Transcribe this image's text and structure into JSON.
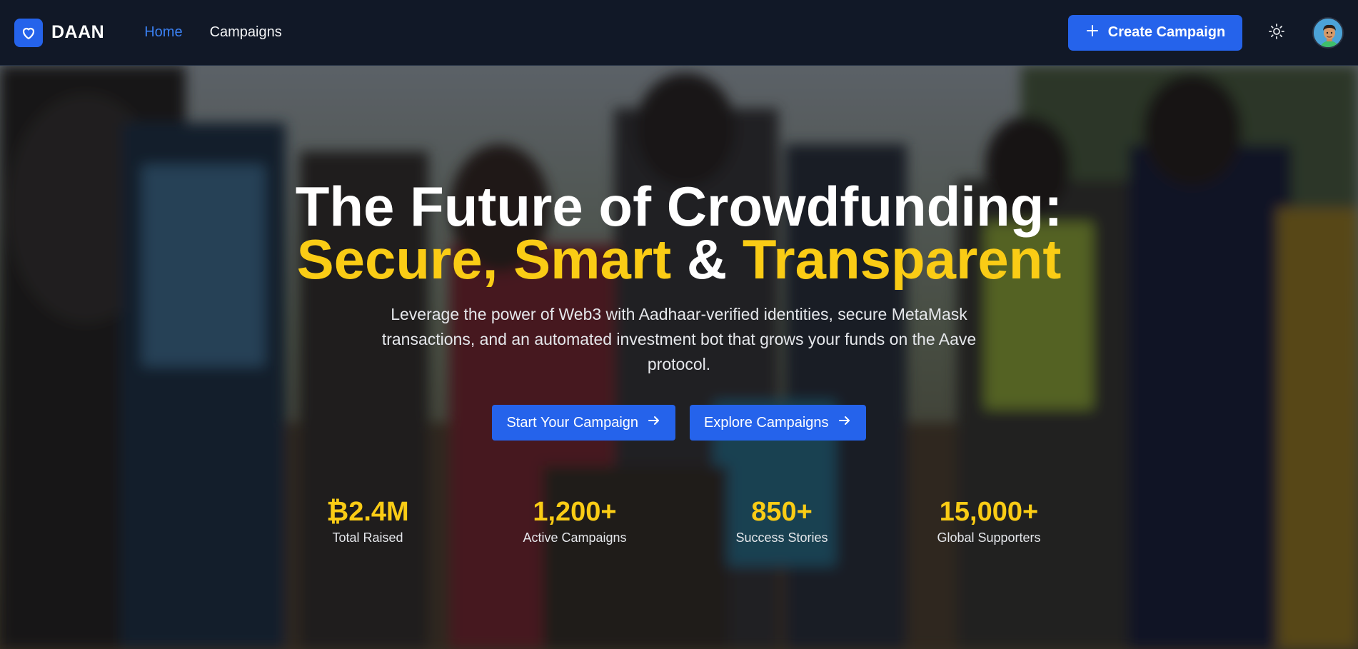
{
  "brand": {
    "name": "DAAN",
    "logo_icon": "heart-icon"
  },
  "nav": {
    "items": [
      {
        "label": "Home",
        "active": true
      },
      {
        "label": "Campaigns",
        "active": false
      }
    ]
  },
  "header_actions": {
    "create_label": "Create Campaign",
    "create_icon": "plus-icon",
    "theme_icon": "sun-icon",
    "avatar_icon": "user-avatar"
  },
  "hero": {
    "title_line1": "The Future of Crowdfunding:",
    "title_line2_part1": "Secure, Smart",
    "title_line2_amp": " & ",
    "title_line2_part2": "Transparent",
    "subtitle": "Leverage the power of Web3 with Aadhaar-verified identities, secure MetaMask transactions, and an automated investment bot that grows your funds on the Aave protocol.",
    "cta_primary": "Start Your Campaign",
    "cta_secondary": "Explore Campaigns",
    "cta_icon": "arrow-right-icon"
  },
  "stats": [
    {
      "value": "₿2.4M",
      "label": "Total Raised"
    },
    {
      "value": "1,200+",
      "label": "Active Campaigns"
    },
    {
      "value": "850+",
      "label": "Success Stories"
    },
    {
      "value": "15,000+",
      "label": "Global Supporters"
    }
  ],
  "colors": {
    "nav_bg": "#111827",
    "accent_blue": "#2563eb",
    "active_link": "#3b82f6",
    "highlight_yellow": "#facc15"
  }
}
